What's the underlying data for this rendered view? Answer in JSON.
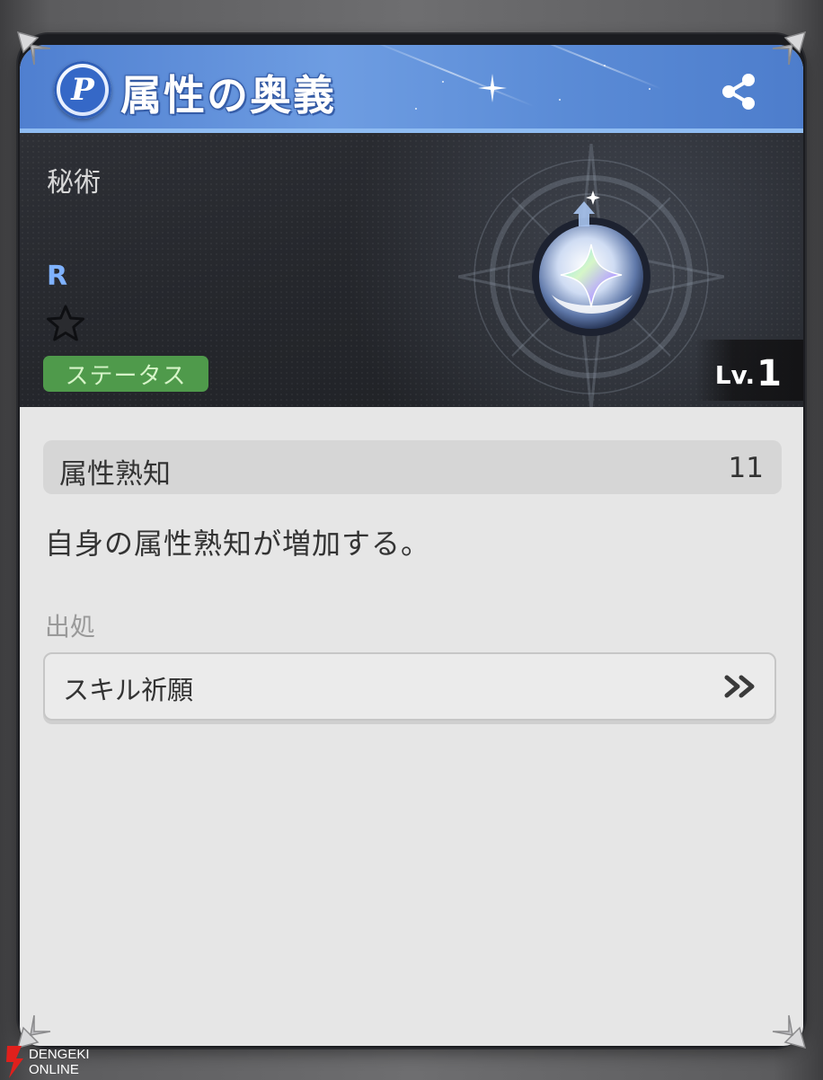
{
  "header": {
    "icon_letter": "P",
    "title": "属性の奥義",
    "share_icon": "share-icon"
  },
  "banner": {
    "category": "秘術",
    "rarity": "R",
    "star_icon": "star-outline-icon",
    "status_badge": "ステータス",
    "level_prefix": "Lv.",
    "level_value": "1"
  },
  "stat": {
    "name": "属性熟知",
    "value": "11"
  },
  "description": "自身の属性熟知が増加する。",
  "source": {
    "label": "出処",
    "button_label": "スキル祈願",
    "button_icon": "double-chevron-right-icon"
  },
  "watermark": {
    "line1": "DENGEKI",
    "line2": "ONLINE"
  },
  "colors": {
    "header_blue": "#5a8bd6",
    "rarity_blue": "#7fb2ff",
    "status_green": "#4f9a4b",
    "panel_bg": "#e6e6e6"
  }
}
